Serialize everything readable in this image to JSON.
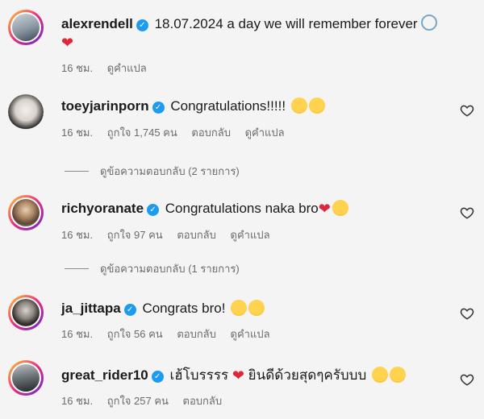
{
  "comments": [
    {
      "username": "alexrendell",
      "text": "18.07.2024 a day we will remember forever",
      "time": "16 ชม.",
      "translate": "ดูคำแปล"
    },
    {
      "username": "toeyjarinporn",
      "text": "Congratulations!!!!!",
      "time": "16 ชม.",
      "likes": "ถูกใจ 1,745 คน",
      "reply": "ตอบกลับ",
      "translate": "ดูคำแปล",
      "view_replies": "ดูข้อความตอบกลับ (2 รายการ)"
    },
    {
      "username": "richyoranate",
      "text": "Congratulations naka bro",
      "time": "16 ชม.",
      "likes": "ถูกใจ 97 คน",
      "reply": "ตอบกลับ",
      "translate": "ดูคำแปล",
      "view_replies": "ดูข้อความตอบกลับ (1 รายการ)"
    },
    {
      "username": "ja_jittapa",
      "text": "Congrats bro!",
      "time": "16 ชม.",
      "likes": "ถูกใจ 56 คน",
      "reply": "ตอบกลับ",
      "translate": "ดูคำแปล"
    },
    {
      "username": "great_rider10",
      "text": "เฮ้โบรรรร",
      "text2": "ยินดีด้วยสุดๆครับบบ",
      "time": "16 ชม.",
      "likes": "ถูกใจ 257 คน",
      "reply": "ตอบกลับ"
    }
  ],
  "icons": {
    "verified": "verified-badge-icon",
    "like": "heart-outline-icon",
    "heart_emoji": "red-heart-emoji",
    "smile_emoji": "smiling-face-emoji",
    "ring_emoji": "ring-emoji"
  },
  "colors": {
    "verified": "#1d9bf0",
    "heart": "#e0263a",
    "meta_text": "#6b6b6b"
  }
}
